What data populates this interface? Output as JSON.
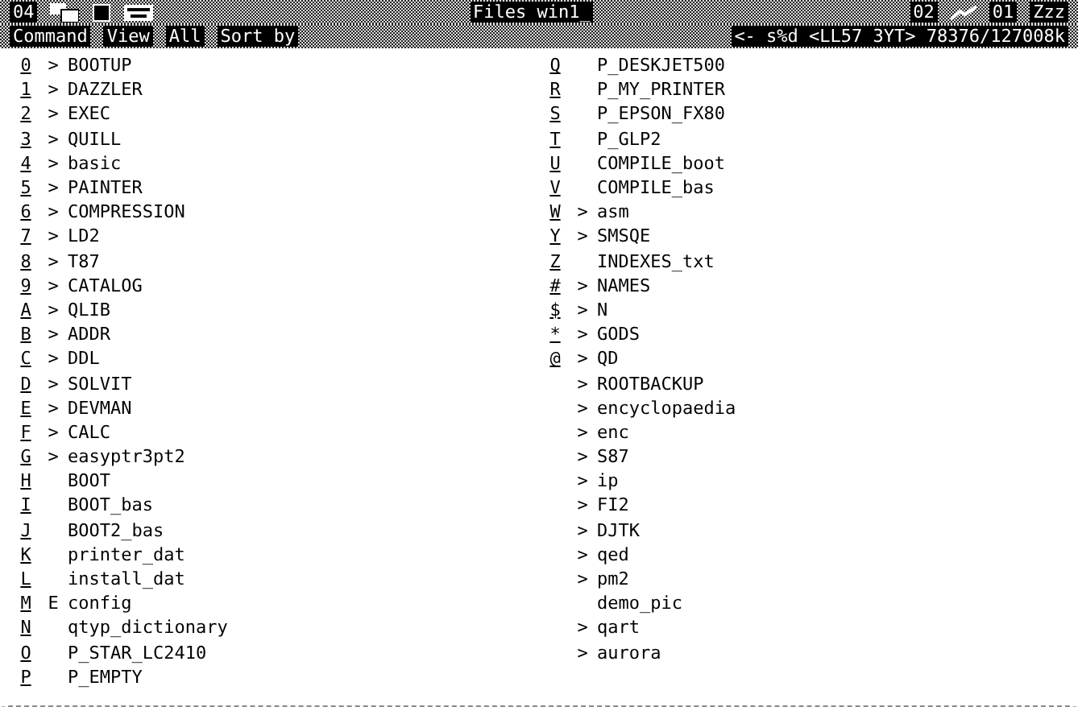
{
  "title_bar": {
    "left_label": "04",
    "title": "Files win1_",
    "right_labels": [
      "02",
      "01"
    ],
    "sleep": "Zzz"
  },
  "menu": [
    {
      "label": "Command"
    },
    {
      "label": "View"
    },
    {
      "label": "All"
    },
    {
      "label": "Sort by"
    }
  ],
  "status": "<- s%d <LL57 3YT> 78376/127008k",
  "columns": [
    [
      {
        "key": "0",
        "marker": ">",
        "name": "BOOTUP"
      },
      {
        "key": "1",
        "marker": ">",
        "name": "DAZZLER"
      },
      {
        "key": "2",
        "marker": ">",
        "name": "EXEC"
      },
      {
        "key": "3",
        "marker": ">",
        "name": "QUILL"
      },
      {
        "key": "4",
        "marker": ">",
        "name": "basic"
      },
      {
        "key": "5",
        "marker": ">",
        "name": "PAINTER"
      },
      {
        "key": "6",
        "marker": ">",
        "name": "COMPRESSION"
      },
      {
        "key": "7",
        "marker": ">",
        "name": "LD2"
      },
      {
        "key": "8",
        "marker": ">",
        "name": "T87"
      },
      {
        "key": "9",
        "marker": ">",
        "name": "CATALOG"
      },
      {
        "key": "A",
        "marker": ">",
        "name": "QLIB"
      },
      {
        "key": "B",
        "marker": ">",
        "name": "ADDR"
      },
      {
        "key": "C",
        "marker": ">",
        "name": "DDL"
      },
      {
        "key": "D",
        "marker": ">",
        "name": "SOLVIT"
      },
      {
        "key": "E",
        "marker": ">",
        "name": "DEVMAN"
      },
      {
        "key": "F",
        "marker": ">",
        "name": "CALC"
      },
      {
        "key": "G",
        "marker": ">",
        "name": "easyptr3pt2"
      },
      {
        "key": "H",
        "name": "BOOT"
      },
      {
        "key": "I",
        "name": "BOOT_bas"
      },
      {
        "key": "J",
        "name": "BOOT2_bas"
      },
      {
        "key": "K",
        "name": "printer_dat"
      },
      {
        "key": "L",
        "name": "install_dat"
      },
      {
        "key": "M",
        "marker": "E",
        "name": "config"
      },
      {
        "key": "N",
        "name": "qtyp_dictionary"
      },
      {
        "key": "O",
        "name": "P_STAR_LC2410"
      },
      {
        "key": "P",
        "name": "P_EMPTY"
      }
    ],
    [
      {
        "key": "Q",
        "name": "P_DESKJET500"
      },
      {
        "key": "R",
        "name": "P_MY_PRINTER"
      },
      {
        "key": "S",
        "name": "P_EPSON_FX80"
      },
      {
        "key": "T",
        "name": "P_GLP2"
      },
      {
        "key": "U",
        "name": "COMPILE_boot"
      },
      {
        "key": "V",
        "name": "COMPILE_bas"
      },
      {
        "key": "W",
        "marker": ">",
        "name": "asm"
      },
      {
        "key": "Y",
        "marker": ">",
        "name": "SMSQE"
      },
      {
        "key": "Z",
        "name": "INDEXES_txt"
      },
      {
        "key": "#",
        "marker": ">",
        "name": "NAMES"
      },
      {
        "key": "$",
        "marker": ">",
        "name": "N"
      },
      {
        "key": "*",
        "marker": ">",
        "name": "GODS"
      },
      {
        "key": "@",
        "marker": ">",
        "name": "QD"
      },
      {
        "marker": ">",
        "name": "ROOTBACKUP"
      },
      {
        "marker": ">",
        "name": "encyclopaedia"
      },
      {
        "marker": ">",
        "name": "enc"
      },
      {
        "marker": ">",
        "name": "S87"
      },
      {
        "marker": ">",
        "name": "ip"
      },
      {
        "marker": ">",
        "name": "FI2"
      },
      {
        "marker": ">",
        "name": "DJTK"
      },
      {
        "marker": ">",
        "name": "qed"
      },
      {
        "marker": ">",
        "name": "pm2"
      },
      {
        "name": "demo_pic"
      },
      {
        "marker": ">",
        "name": "qart"
      },
      {
        "marker": ">",
        "name": "aurora"
      }
    ]
  ]
}
